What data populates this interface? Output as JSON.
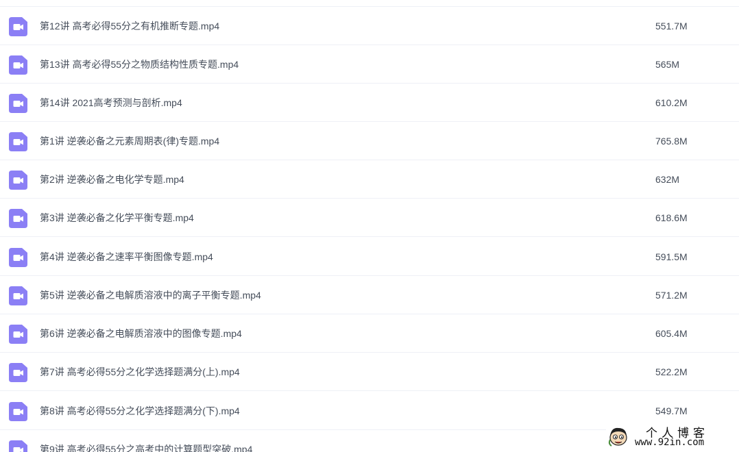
{
  "files": [
    {
      "name": "第12讲 高考必得55分之有机推断专题.mp4",
      "size": "551.7M",
      "icon": "video-file-icon"
    },
    {
      "name": "第13讲 高考必得55分之物质结构性质专题.mp4",
      "size": "565M",
      "icon": "video-file-icon"
    },
    {
      "name": "第14讲 2021高考预测与剖析.mp4",
      "size": "610.2M",
      "icon": "video-file-icon"
    },
    {
      "name": "第1讲 逆袭必备之元素周期表(律)专题.mp4",
      "size": "765.8M",
      "icon": "video-file-icon"
    },
    {
      "name": "第2讲 逆袭必备之电化学专题.mp4",
      "size": "632M",
      "icon": "video-file-icon"
    },
    {
      "name": "第3讲 逆袭必备之化学平衡专题.mp4",
      "size": "618.6M",
      "icon": "video-file-icon"
    },
    {
      "name": "第4讲 逆袭必备之速率平衡图像专题.mp4",
      "size": "591.5M",
      "icon": "video-file-icon"
    },
    {
      "name": "第5讲 逆袭必备之电解质溶液中的离子平衡专题.mp4",
      "size": "571.2M",
      "icon": "video-file-icon"
    },
    {
      "name": "第6讲 逆袭必备之电解质溶液中的图像专题.mp4",
      "size": "605.4M",
      "icon": "video-file-icon"
    },
    {
      "name": "第7讲 高考必得55分之化学选择题满分(上).mp4",
      "size": "522.2M",
      "icon": "video-file-icon"
    },
    {
      "name": "第8讲 高考必得55分之化学选择题满分(下).mp4",
      "size": "549.7M",
      "icon": "video-file-icon"
    },
    {
      "name": "第9讲 高考必得55分之高考中的计算题型突破.mp4",
      "size": "",
      "icon": "video-file-icon"
    }
  ],
  "watermark": {
    "title": "个人博客",
    "url": "www.92in.com"
  },
  "colors": {
    "icon_purple": "#8b7ff5",
    "text": "#454d5a",
    "divider": "#eef0f6"
  }
}
